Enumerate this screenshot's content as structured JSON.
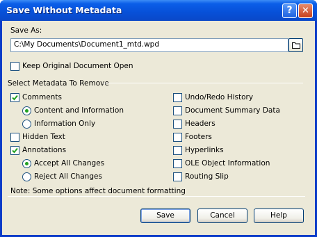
{
  "window": {
    "title": "Save Without Metadata",
    "help_glyph": "?",
    "close_glyph": "✕"
  },
  "save_as": {
    "label": "Save As:",
    "value": "C:\\My Documents\\Document1_mtd.wpd",
    "browse_icon": "folder-icon"
  },
  "keep_open": {
    "label": "Keep Original Document Open",
    "checked": false
  },
  "group": {
    "title": "Select Metadata To Remove"
  },
  "left_column": {
    "comments": {
      "label": "Comments",
      "checked": true
    },
    "comments_options": [
      {
        "label": "Content and Information",
        "selected": true
      },
      {
        "label": "Information Only",
        "selected": false
      }
    ],
    "hidden_text": {
      "label": "Hidden Text",
      "checked": false
    },
    "annotations": {
      "label": "Annotations",
      "checked": true
    },
    "annotations_options": [
      {
        "label": "Accept All Changes",
        "selected": true
      },
      {
        "label": "Reject All Changes",
        "selected": false
      }
    ]
  },
  "right_column": [
    {
      "label": "Undo/Redo History",
      "checked": false
    },
    {
      "label": "Document Summary Data",
      "checked": false
    },
    {
      "label": "Headers",
      "checked": false
    },
    {
      "label": "Footers",
      "checked": false
    },
    {
      "label": "Hyperlinks",
      "checked": false
    },
    {
      "label": "OLE Object Information",
      "checked": false
    },
    {
      "label": "Routing Slip",
      "checked": false
    }
  ],
  "note": "Note: Some options affect document formatting",
  "buttons": {
    "save": "Save",
    "cancel": "Cancel",
    "help": "Help"
  },
  "colors": {
    "titlebar": "#0a5ee8",
    "client": "#ece9d8",
    "check": "#21a121"
  }
}
